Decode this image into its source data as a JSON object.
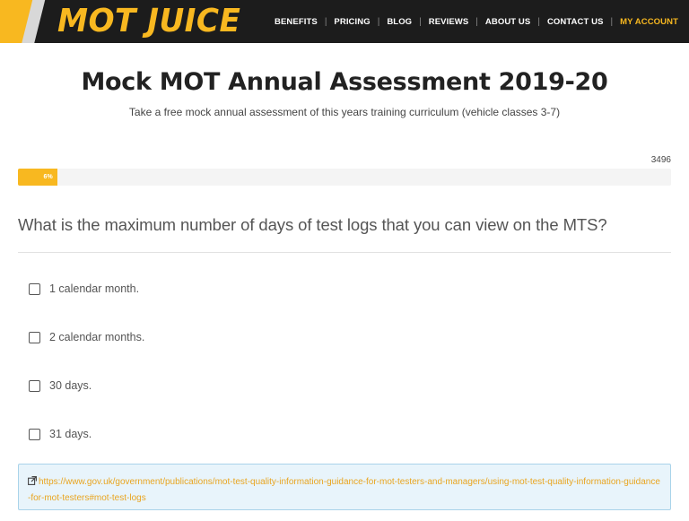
{
  "header": {
    "logo_text": "MOT JUICE",
    "nav": [
      {
        "label": "BENEFITS"
      },
      {
        "label": "PRICING"
      },
      {
        "label": "BLOG"
      },
      {
        "label": "REVIEWS"
      },
      {
        "label": "ABOUT US"
      },
      {
        "label": "CONTACT US"
      },
      {
        "label": "MY ACCOUNT",
        "active": true
      }
    ]
  },
  "page": {
    "title": "Mock MOT Annual Assessment 2019-20",
    "subtitle": "Take a free mock annual assessment of this years training curriculum (vehicle classes 3-7)"
  },
  "progress": {
    "counter": "3496",
    "percent_label": "6%",
    "percent": 6
  },
  "question": {
    "text": "What is the maximum number of days of test logs that you can view on the MTS?",
    "answers": [
      {
        "label": "1 calendar month.",
        "checked": false
      },
      {
        "label": "2 calendar months.",
        "checked": false
      },
      {
        "label": "30 days.",
        "checked": false
      },
      {
        "label": "31 days.",
        "checked": false
      }
    ]
  },
  "reference": {
    "icon": "external-link-icon",
    "url": "https://www.gov.uk/government/publications/mot-test-quality-information-guidance-for-mot-testers-and-managers/using-mot-test-quality-information-guidance-for-mot-testers#mot-test-logs"
  },
  "colors": {
    "accent": "#f8b820",
    "header_bg": "#1c1c1c",
    "info_bg": "#e8f4fb",
    "info_border": "#a9d3ea"
  }
}
